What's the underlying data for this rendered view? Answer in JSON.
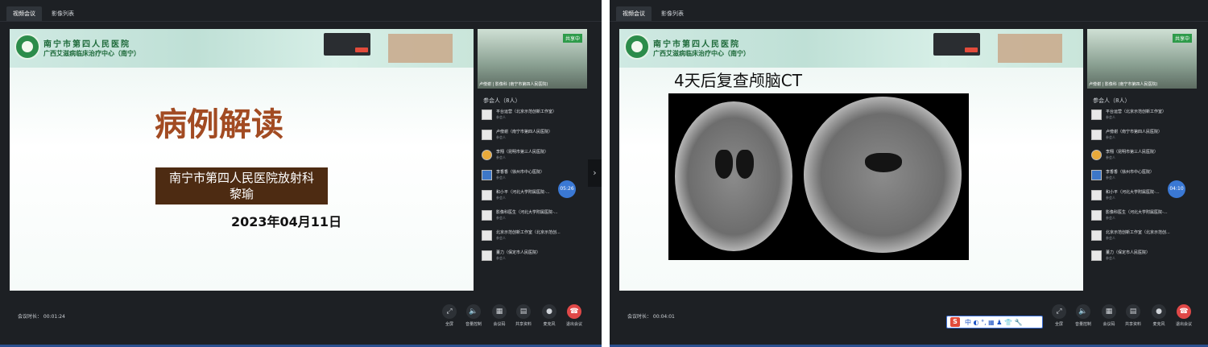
{
  "tabs": [
    "视频会议",
    "影像列表"
  ],
  "hospital": {
    "name": "南宁市第四人民医院",
    "center": "广西艾滋病临床治疗中心（南宁）"
  },
  "slide1": {
    "title": "病例解读",
    "dept": "南宁市第四人民医院放射科",
    "presenter": "黎瑜",
    "date": "2023年04月11日"
  },
  "slide2": {
    "title": "4天后复查颅脑CT"
  },
  "camera": {
    "badge": "共享中",
    "caption": "卢傍谢 | 影像科 (南宁市第四人民医院)"
  },
  "participants_header": "参会人（8人）",
  "participants": [
    {
      "name": "平台运营（北京示范创新工作室）",
      "role": "参会人",
      "avatar": "blank"
    },
    {
      "name": "卢傍谢（南宁市第四人民医院）",
      "role": "参会人",
      "avatar": "blank"
    },
    {
      "name": "李翔（昆明市第三人民医院）",
      "role": "参会人",
      "avatar": "gold"
    },
    {
      "name": "李香香（徐州市中心医院）",
      "role": "参会人",
      "avatar": "doctor"
    },
    {
      "name": "和小平（河北大学附属医院-...",
      "role": "参会人",
      "avatar": "blank"
    },
    {
      "name": "影像科医生（河北大学附属医院-...",
      "role": "参会人",
      "avatar": "blank"
    },
    {
      "name": "北京示范创新工作室（北京示范创...",
      "role": "参会人",
      "avatar": "blank"
    },
    {
      "name": "董力（保定市人民医院）",
      "role": "参会人",
      "avatar": "blank"
    }
  ],
  "screen1": {
    "timer": "05:26",
    "duration": "会议时长： 00:01:24"
  },
  "screen2": {
    "timer": "04:10",
    "duration": "会议时长： 00:04:01"
  },
  "controls": [
    "全屏",
    "音量控制",
    "会议码",
    "共享资料",
    "麦克风",
    "退出会议"
  ],
  "ime_text": "中 ◐ °, ▦ ♟ 👕 🔧",
  "colors": {
    "background": "#1d2024",
    "end_call": "#e04848",
    "accent": "#3a78d4"
  }
}
